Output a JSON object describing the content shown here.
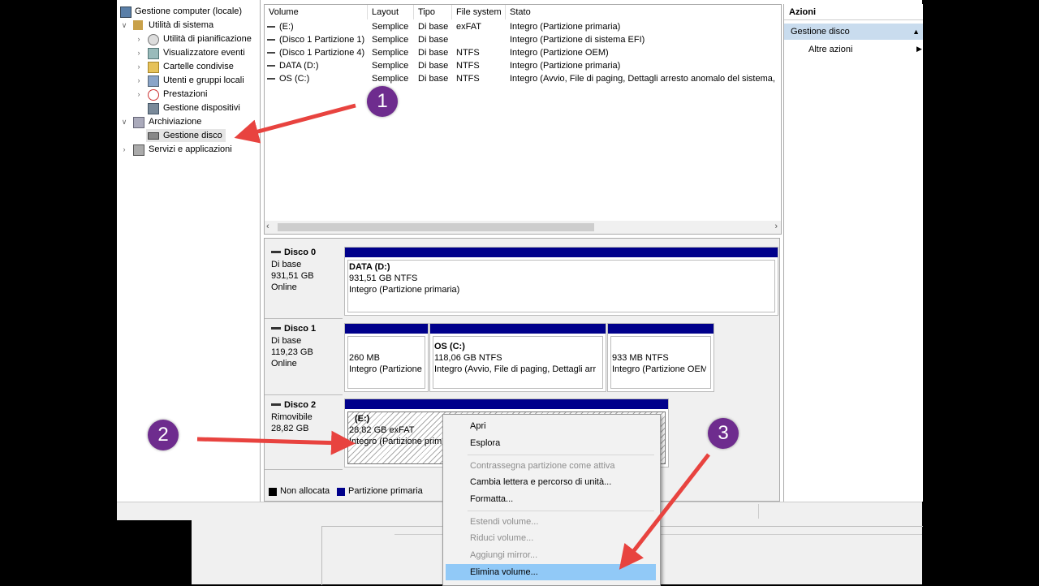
{
  "tree": {
    "root": "Gestione computer (locale)",
    "system_tools": "Utilità di sistema",
    "task_scheduler": "Utilità di pianificazione",
    "event_viewer": "Visualizzatore eventi",
    "shared_folders": "Cartelle condivise",
    "users_groups": "Utenti e gruppi locali",
    "performance": "Prestazioni",
    "device_manager": "Gestione dispositivi",
    "storage": "Archiviazione",
    "disk_management": "Gestione disco",
    "services": "Servizi e applicazioni"
  },
  "volumes": {
    "columns": [
      "Volume",
      "Layout",
      "Tipo",
      "File system",
      "Stato"
    ],
    "rows": [
      {
        "volume": "(E:)",
        "layout": "Semplice",
        "tipo": "Di base",
        "fs": "exFAT",
        "stato": "Integro (Partizione primaria)"
      },
      {
        "volume": "(Disco 1 Partizione 1)",
        "layout": "Semplice",
        "tipo": "Di base",
        "fs": "",
        "stato": "Integro (Partizione di sistema EFI)"
      },
      {
        "volume": "(Disco 1 Partizione 4)",
        "layout": "Semplice",
        "tipo": "Di base",
        "fs": "NTFS",
        "stato": "Integro (Partizione OEM)"
      },
      {
        "volume": "DATA (D:)",
        "layout": "Semplice",
        "tipo": "Di base",
        "fs": "NTFS",
        "stato": "Integro (Partizione primaria)"
      },
      {
        "volume": "OS (C:)",
        "layout": "Semplice",
        "tipo": "Di base",
        "fs": "NTFS",
        "stato": "Integro (Avvio, File di paging, Dettagli arresto anomalo del sistema,"
      }
    ]
  },
  "disks": [
    {
      "name": "Disco 0",
      "type": "Di base",
      "size": "931,51 GB",
      "status": "Online",
      "partitions": [
        {
          "title": "DATA  (D:)",
          "size": "931,51 GB NTFS",
          "status": "Integro (Partizione primaria)"
        }
      ]
    },
    {
      "name": "Disco 1",
      "type": "Di base",
      "size": "119,23 GB",
      "status": "Online",
      "partitions": [
        {
          "title": "",
          "size": "260 MB",
          "status": "Integro (Partizione"
        },
        {
          "title": "OS  (C:)",
          "size": "118,06 GB NTFS",
          "status": "Integro (Avvio, File di paging, Dettagli arr"
        },
        {
          "title": "",
          "size": "933 MB NTFS",
          "status": "Integro (Partizione OEM"
        }
      ]
    },
    {
      "name": "Disco 2",
      "type": "Rimovibile",
      "size": "28,82 GB",
      "status": "",
      "partitions": [
        {
          "title": "(E:)",
          "size": "28,82 GB exFAT",
          "status": "Integro (Partizione prim"
        }
      ]
    }
  ],
  "legend": {
    "unallocated": "Non allocata",
    "primary": "Partizione primaria",
    "unallocated_color": "#000000",
    "primary_color": "#00008b"
  },
  "actions": {
    "title": "Azioni",
    "selected": "Gestione disco",
    "more": "Altre azioni"
  },
  "context_menu": {
    "open": "Apri",
    "explore": "Esplora",
    "mark_active": "Contrassegna partizione come attiva",
    "change_letter": "Cambia lettera e percorso di unità...",
    "format": "Formatta...",
    "extend": "Estendi volume...",
    "shrink": "Riduci volume...",
    "add_mirror": "Aggiungi mirror...",
    "delete": "Elimina volume..."
  },
  "annotations": {
    "step1": "1",
    "step2": "2",
    "step3": "3",
    "arrow_color": "#e8433f",
    "circle_color": "#6e2c8e"
  }
}
